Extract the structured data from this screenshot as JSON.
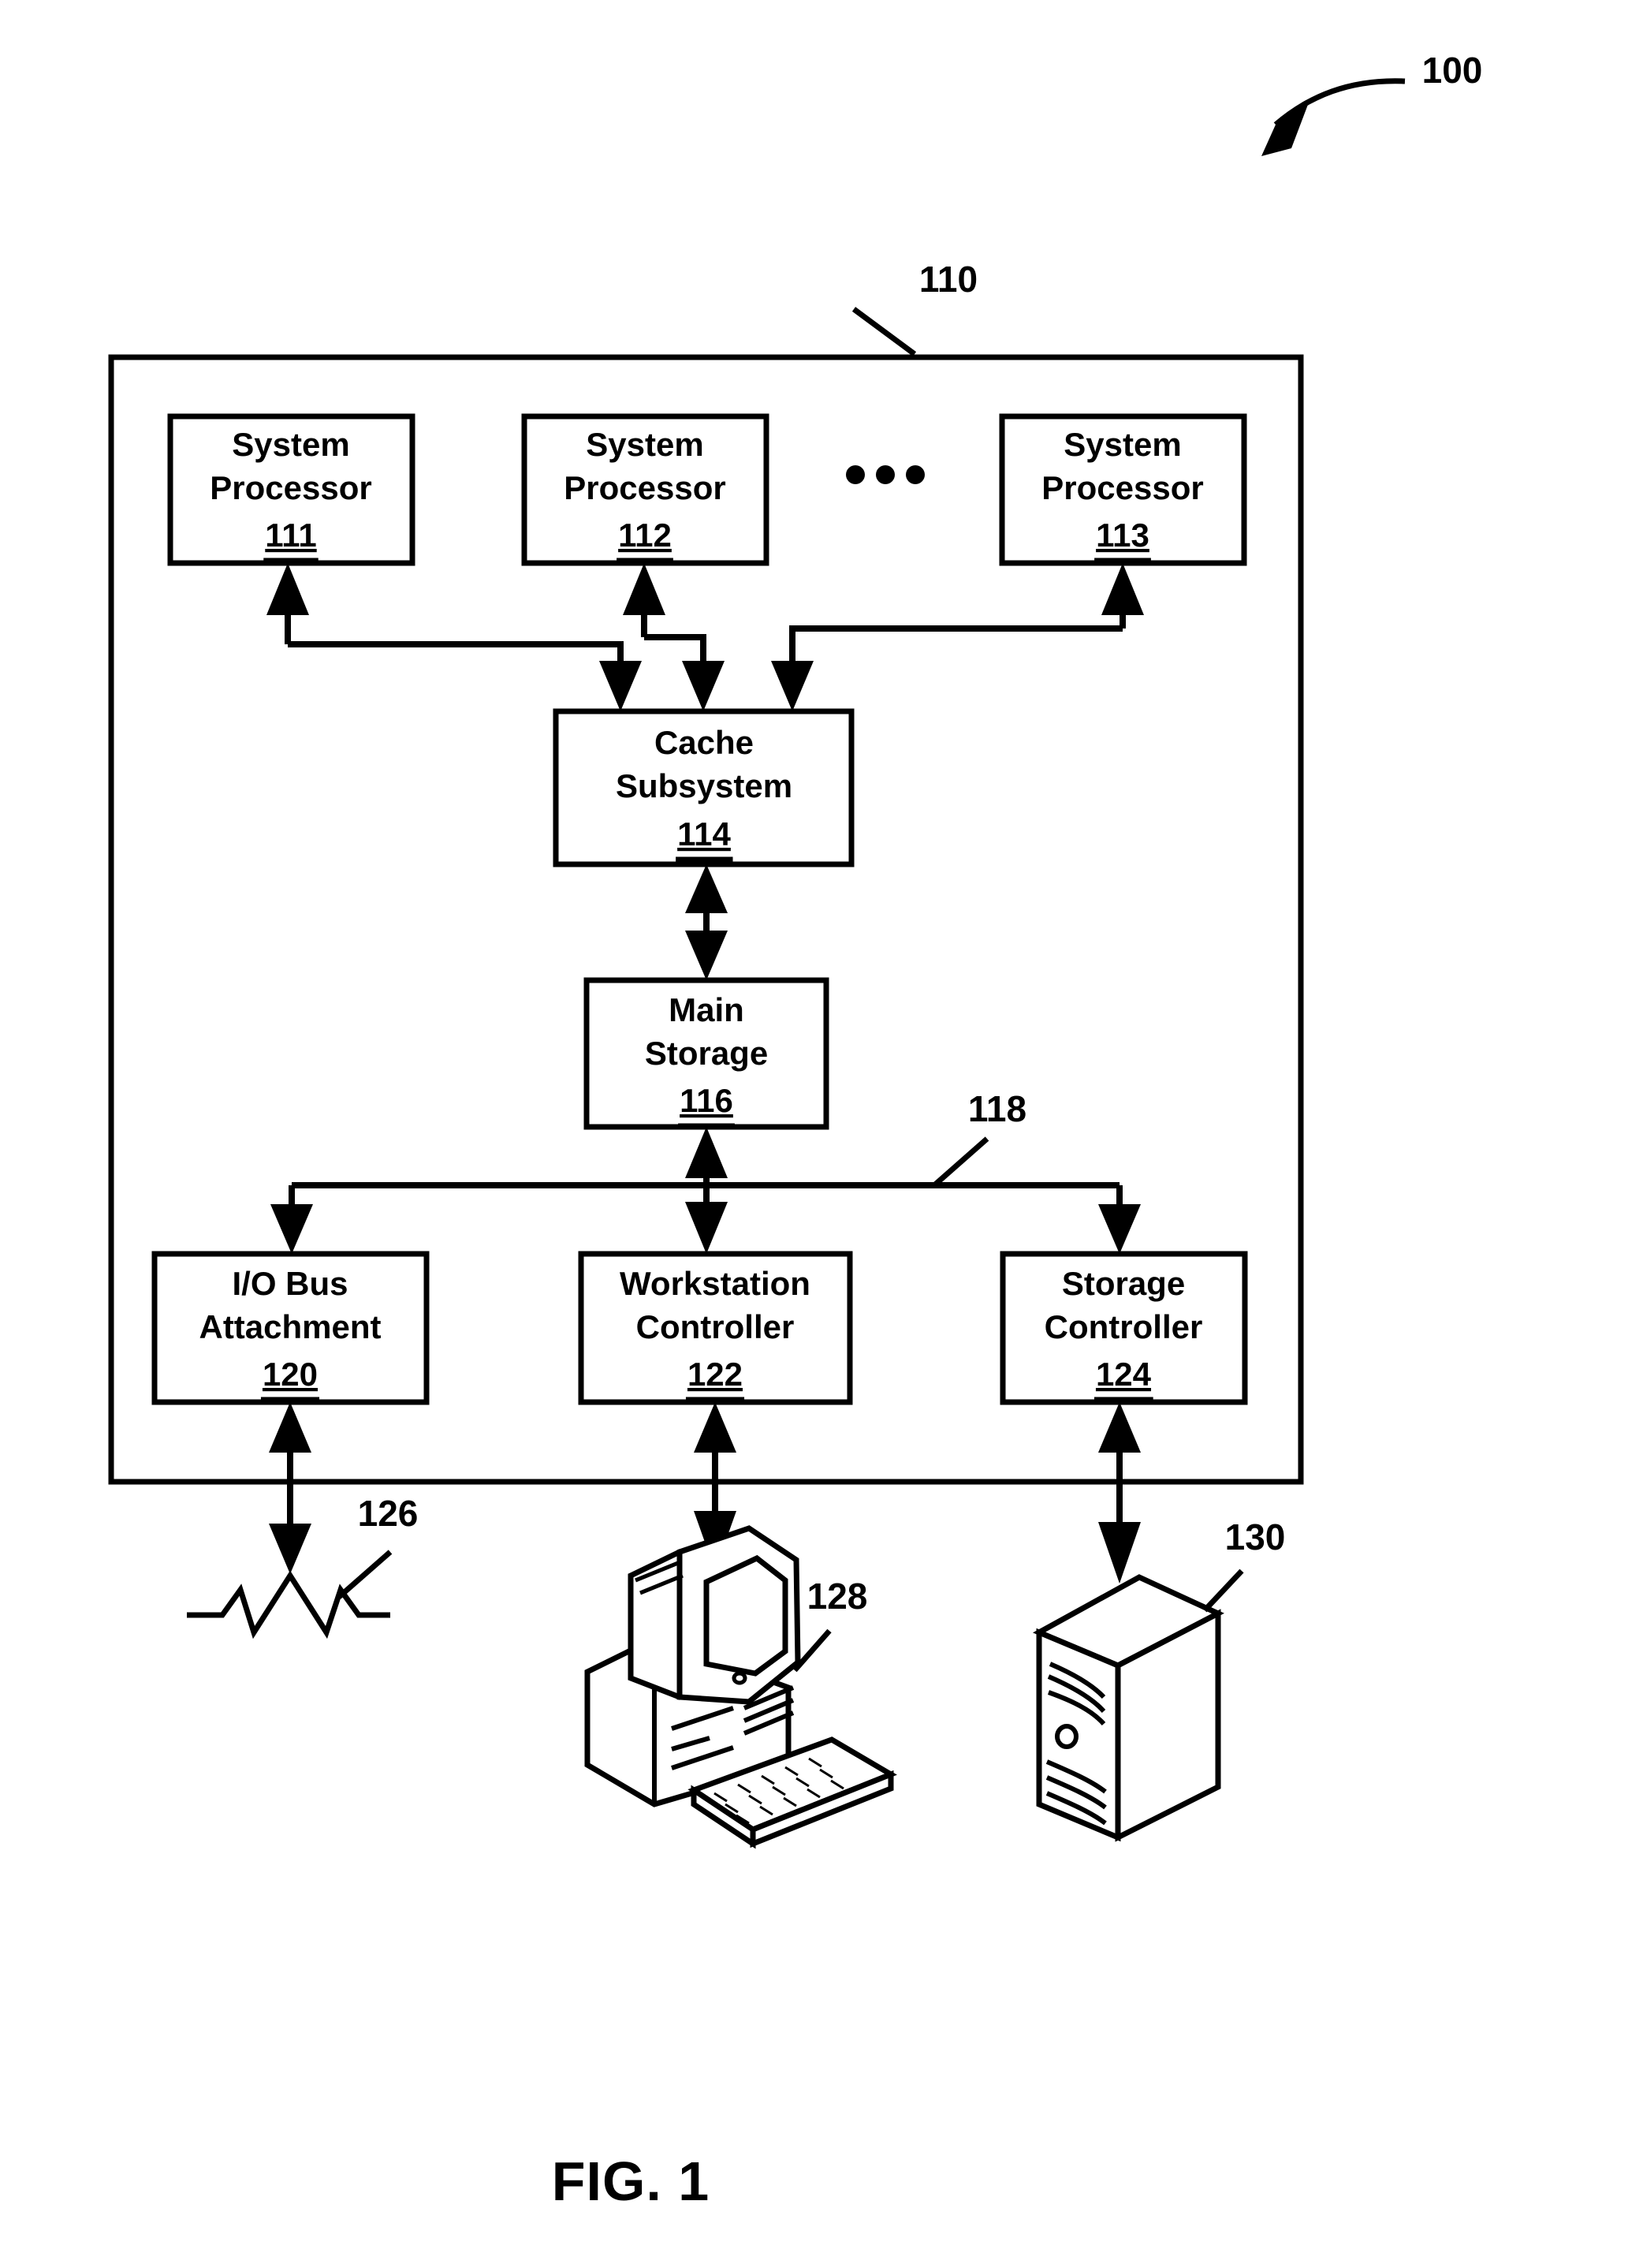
{
  "figure": {
    "caption": "FIG. 1",
    "system_callout": "100"
  },
  "system_frame": {
    "name": "computer system enclosure",
    "callout": "110"
  },
  "processors": [
    {
      "line1": "System",
      "line2": "Processor",
      "ref": "111"
    },
    {
      "line1": "System",
      "line2": "Processor",
      "ref": "112"
    },
    {
      "line1": "System",
      "line2": "Processor",
      "ref": "113"
    }
  ],
  "ellipsis": "• • •",
  "cache": {
    "line1": "Cache",
    "line2": "Subsystem",
    "ref": "114"
  },
  "main_storage": {
    "line1": "Main",
    "line2": "Storage",
    "ref": "116"
  },
  "bus": {
    "callout": "118"
  },
  "controllers": [
    {
      "line1": "I/O Bus",
      "line2": "Attachment",
      "ref": "120"
    },
    {
      "line1": "Workstation",
      "line2": "Controller",
      "ref": "122"
    },
    {
      "line1": "Storage",
      "line2": "Controller",
      "ref": "124"
    }
  ],
  "peripherals": [
    {
      "icon": "io-bus-zigzag-icon",
      "callout": "126"
    },
    {
      "icon": "workstation-computer-icon",
      "callout": "128"
    },
    {
      "icon": "storage-server-tower-icon",
      "callout": "130"
    }
  ],
  "colors": {
    "ink": "#000000",
    "paper": "#ffffff"
  }
}
